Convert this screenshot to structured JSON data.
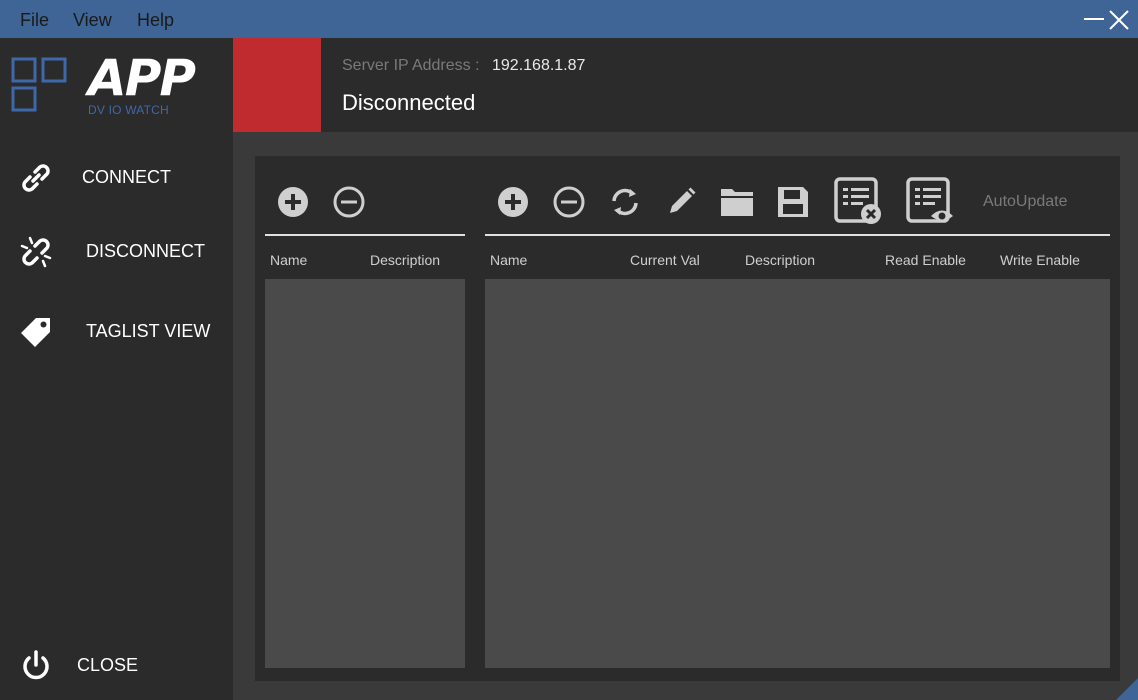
{
  "menubar": {
    "items": [
      "File",
      "View",
      "Help"
    ]
  },
  "logo": {
    "title": "APP",
    "subtitle": "DV IO WATCH"
  },
  "sidebar": {
    "items": [
      {
        "label": "CONNECT",
        "icon": "link-icon"
      },
      {
        "label": "DISCONNECT",
        "icon": "broken-link-icon"
      },
      {
        "label": "TAGLIST VIEW",
        "icon": "tag-icon"
      }
    ],
    "close": {
      "label": "CLOSE",
      "icon": "power-icon"
    }
  },
  "header": {
    "ip_label": "Server IP Address :",
    "ip_value": "192.168.1.87",
    "status": "Disconnected",
    "status_color": "#bf2b2f"
  },
  "left_table": {
    "columns": [
      "Name",
      "Description"
    ],
    "rows": []
  },
  "right_table": {
    "columns": [
      "Name",
      "Current Val",
      "Description",
      "Read Enable",
      "Write Enable"
    ],
    "rows": []
  },
  "toolbar": {
    "autoupdate_label": "AutoUpdate"
  },
  "colors": {
    "accent": "#3f6496",
    "sidebar_bg": "#2b2b2b",
    "table_bg": "#4a4a4a"
  }
}
